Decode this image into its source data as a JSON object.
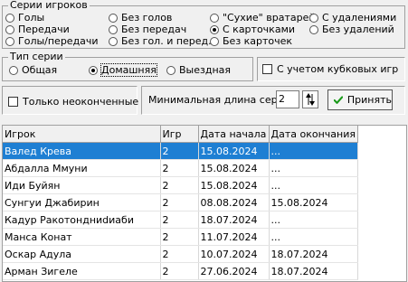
{
  "series_group": {
    "legend": "Серии игроков",
    "options": [
      {
        "label": "Голы",
        "selected": false
      },
      {
        "label": "Передачи",
        "selected": false
      },
      {
        "label": "Голы/передачи",
        "selected": false
      },
      {
        "label": "Без голов",
        "selected": false
      },
      {
        "label": "Без передач",
        "selected": false
      },
      {
        "label": "Без гол. и перед.",
        "selected": false
      },
      {
        "label": "\"Сухие\" вратарей",
        "selected": false
      },
      {
        "label": "С карточками",
        "selected": true
      },
      {
        "label": "Без карточек",
        "selected": false
      },
      {
        "label": "С удалениями",
        "selected": false
      },
      {
        "label": "Без удалений",
        "selected": false
      }
    ]
  },
  "type_group": {
    "legend": "Тип серии",
    "options": [
      {
        "label": "Общая",
        "selected": false
      },
      {
        "label": "Домашняя",
        "selected": true
      },
      {
        "label": "Выездная",
        "selected": false
      }
    ]
  },
  "cup_checkbox": {
    "label": "С учетом кубковых игр",
    "checked": false
  },
  "unfinished_checkbox": {
    "label": "Только неоконченные",
    "checked": false
  },
  "min_length": {
    "label": "Минимальная длина серии",
    "value": "2"
  },
  "accept_button": {
    "label": "Принять"
  },
  "table": {
    "columns": [
      "Игрок",
      "Игр",
      "Дата начала",
      "Дата окончания"
    ],
    "selected_row": 0,
    "rows": [
      [
        "Валед Крева",
        "2",
        "15.08.2024",
        "..."
      ],
      [
        "Абдалла Ммуни",
        "2",
        "15.08.2024",
        "..."
      ],
      [
        "Иди Буйян",
        "2",
        "15.08.2024",
        "..."
      ],
      [
        "Сунгуи Джабирин",
        "2",
        "08.08.2024",
        "15.08.2024"
      ],
      [
        "Кадур Ракотондниdиаби",
        "2",
        "18.07.2024",
        "..."
      ],
      [
        "Манса Конат",
        "2",
        "11.07.2024",
        "..."
      ],
      [
        "Оскар Адула",
        "2",
        "10.07.2024",
        "18.07.2024"
      ],
      [
        "Арман Зигеле",
        "2",
        "27.06.2024",
        "18.07.2024"
      ]
    ]
  },
  "colors": {
    "selection": "#1e7fd3",
    "check_green": "#1a9a1a"
  }
}
